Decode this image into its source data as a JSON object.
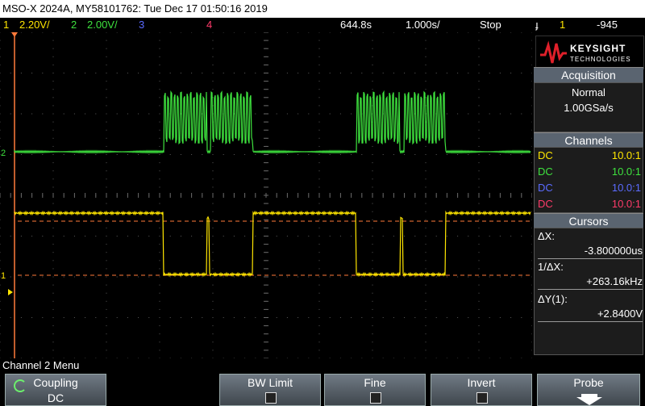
{
  "title": "MSO-X 2024A, MY58101762: Tue Dec 17 01:50:16 2019",
  "status": {
    "ch1_num": "1",
    "ch1_scale": "2.20V/",
    "ch2_num": "2",
    "ch2_scale": "2.00V/",
    "ch3_num": "3",
    "ch4_num": "4",
    "delay": "644.8s",
    "timebase": "1.000s/",
    "run_state": "Stop",
    "trigger_ch": "1",
    "trigger_level": "-945"
  },
  "brand": {
    "name": "KEYSIGHT",
    "sub": "TECHNOLOGIES"
  },
  "acquisition": {
    "header": "Acquisition",
    "mode": "Normal",
    "rate": "1.00GSa/s"
  },
  "channels": {
    "header": "Channels",
    "rows": [
      {
        "coupling": "DC",
        "probe": "10.0:1",
        "color": "#ffe600"
      },
      {
        "coupling": "DC",
        "probe": "10.0:1",
        "color": "#3ee23e"
      },
      {
        "coupling": "DC",
        "probe": "10.0:1",
        "color": "#5b6bff"
      },
      {
        "coupling": "DC",
        "probe": "10.0:1",
        "color": "#ff3b6a"
      }
    ]
  },
  "cursors": {
    "header": "Cursors",
    "dx_label": "ΔX:",
    "dx_value": "-3.800000us",
    "inv_label": "1/ΔX:",
    "inv_value": "+263.16kHz",
    "dy_label": "ΔY(1):",
    "dy_value": "+2.8400V"
  },
  "markers": {
    "ch2": "2",
    "ch1": "1"
  },
  "menu_title": "Channel 2 Menu",
  "softkeys": [
    {
      "label": "Coupling",
      "value": "DC"
    },
    {
      "label": "BW Limit"
    },
    {
      "label": "Fine"
    },
    {
      "label": "Invert"
    },
    {
      "label": "Probe"
    }
  ],
  "colors": {
    "ch1": "#ffe600",
    "ch2": "#3ee23e",
    "ch3": "#5b6bff",
    "ch4": "#ff3b6a",
    "cursor": "#ff7a3a"
  }
}
